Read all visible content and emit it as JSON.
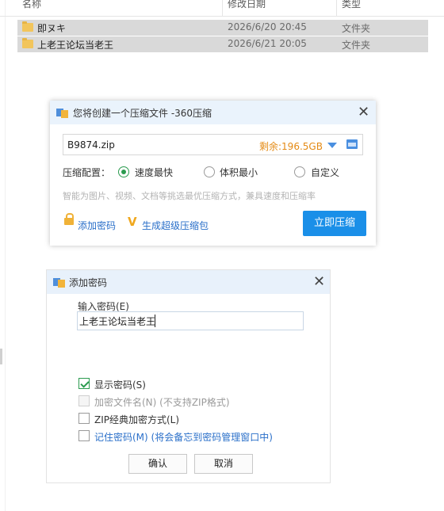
{
  "explorer": {
    "columns": {
      "name": "名称",
      "modified": "修改日期",
      "type": "类型"
    },
    "rows": [
      {
        "name": "即ヌキ",
        "date": "2026/6/20 20:45",
        "type": "文件夹"
      },
      {
        "name": "上老王论坛当老王",
        "date": "2026/6/21 20:05",
        "type": "文件夹"
      }
    ]
  },
  "compress_dialog": {
    "title": "您将创建一个压缩文件 -360压缩",
    "filename": "B9874.zip",
    "free_space": "剩余:196.5GB",
    "config_label": "压缩配置：",
    "options": [
      {
        "label": "速度最快",
        "selected": true
      },
      {
        "label": "体积最小",
        "selected": false
      },
      {
        "label": "自定义",
        "selected": false
      }
    ],
    "hint": "智能为图片、视频、文档等挑选最优压缩方式，兼具速度和压缩率",
    "add_password": "添加密码",
    "super_compress": "生成超级压缩包",
    "compress_now": "立即压缩"
  },
  "password_dialog": {
    "title": "添加密码",
    "input_label": "输入密码(E)",
    "password_value": "上老王论坛当老王",
    "checkboxes": [
      {
        "label": "显示密码(S)",
        "checked": true,
        "disabled": false
      },
      {
        "label": "加密文件名(N) (不支持ZIP格式)",
        "checked": false,
        "disabled": true
      },
      {
        "label": "ZIP经典加密方式(L)",
        "checked": false,
        "disabled": false
      },
      {
        "label": "记住密码(M) (将会备忘到密码管理窗口中)",
        "checked": false,
        "disabled": false
      }
    ],
    "ok": "确认",
    "cancel": "取消"
  },
  "colors": {
    "accent": "#1a8fe8",
    "radio_green": "#2b9b4f",
    "free_space": "#e48a14",
    "link": "#2a6fc9"
  }
}
